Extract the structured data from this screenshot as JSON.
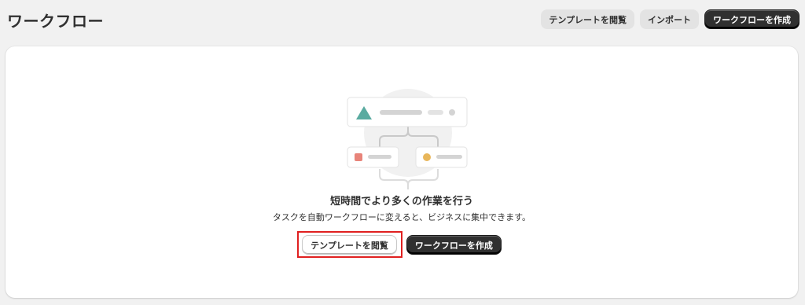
{
  "page": {
    "title": "ワークフロー"
  },
  "header": {
    "browse_templates_label": "テンプレートを閲覧",
    "import_label": "インポート",
    "create_workflow_label": "ワークフローを作成"
  },
  "empty_state": {
    "heading": "短時間でより多くの作業を行う",
    "description": "タスクを自動ワークフローに変えると、ビジネスに集中できます。",
    "browse_templates_label": "テンプレートを閲覧",
    "create_workflow_label": "ワークフローを作成",
    "illustration_icon": "workflow-illustration-icon"
  },
  "colors": {
    "background": "#f1f1f1",
    "card": "#ffffff",
    "primary_button": "#303030",
    "secondary_button": "#e3e3e3",
    "highlight": "#e02020",
    "trigger_teal": "#5aaba0",
    "branch_red": "#e8847a",
    "branch_yellow": "#e8b65a"
  }
}
